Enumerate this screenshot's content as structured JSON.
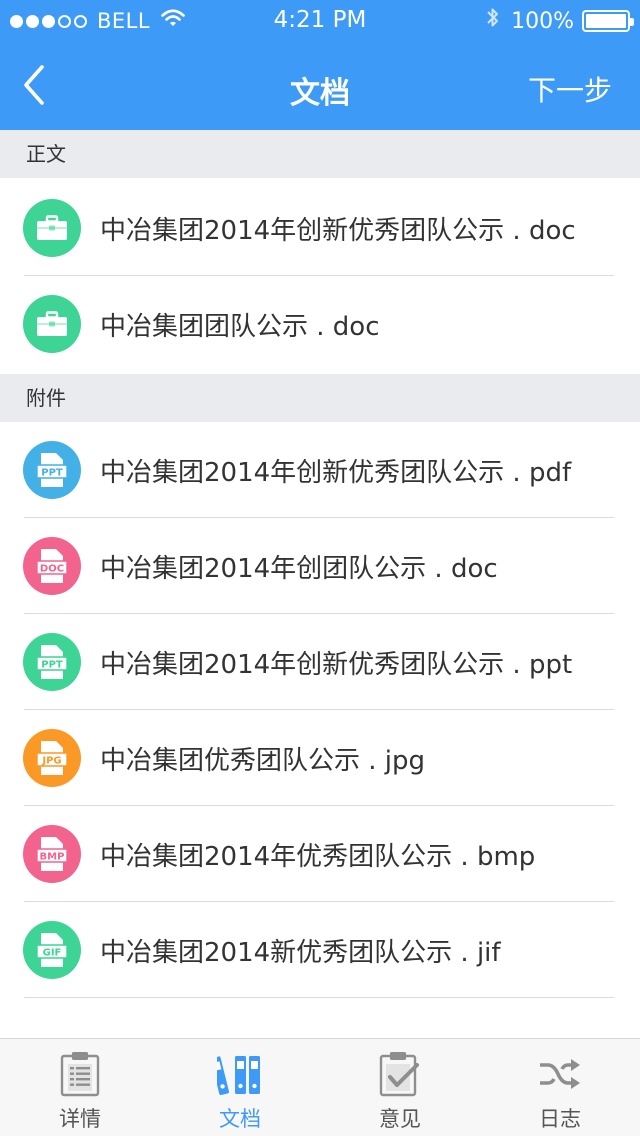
{
  "status_bar": {
    "carrier": "BELL",
    "time": "4:21 PM",
    "battery": "100%",
    "signal_bars_filled": 3,
    "signal_bars_total": 5
  },
  "nav": {
    "title": "文档",
    "next_label": "下一步"
  },
  "sections": [
    {
      "title": "正文",
      "files": [
        {
          "name": "中冶集团2014年创新优秀团队公示 . doc",
          "icon": "briefcase-icon",
          "color": "#3dd495"
        },
        {
          "name": "中冶集团团队公示 . doc",
          "icon": "briefcase-icon",
          "color": "#3dd495"
        }
      ]
    },
    {
      "title": "附件",
      "files": [
        {
          "name": "中冶集团2014年创新优秀团队公示 . pdf",
          "icon": "ppt-file-icon",
          "badge": "PPT",
          "color": "#43b1e6"
        },
        {
          "name": "中冶集团2014年创团队公示 . doc",
          "icon": "doc-file-icon",
          "badge": "DOC",
          "color": "#f2638e"
        },
        {
          "name": "中冶集团2014年创新优秀团队公示 . ppt",
          "icon": "ppt-file-icon",
          "badge": "PPT",
          "color": "#3dd495"
        },
        {
          "name": "中冶集团优秀团队公示 . jpg",
          "icon": "jpg-file-icon",
          "badge": "JPG",
          "color": "#fb9927"
        },
        {
          "name": "中冶集团2014年优秀团队公示 . bmp",
          "icon": "bmp-file-icon",
          "badge": "BMP",
          "color": "#f2638e"
        },
        {
          "name": "中冶集团2014新优秀团队公示 . jif",
          "icon": "gif-file-icon",
          "badge": "GIF",
          "color": "#3dd495"
        }
      ]
    }
  ],
  "tabs": [
    {
      "label": "详情",
      "icon": "clipboard-list-icon",
      "active": false
    },
    {
      "label": "文档",
      "icon": "binders-icon",
      "active": true
    },
    {
      "label": "意见",
      "icon": "clipboard-check-icon",
      "active": false
    },
    {
      "label": "日志",
      "icon": "shuffle-icon",
      "active": false
    }
  ],
  "colors": {
    "primary": "#3d9bf7",
    "section_bg": "#e9ebee",
    "tab_inactive": "#8e8e8e"
  }
}
